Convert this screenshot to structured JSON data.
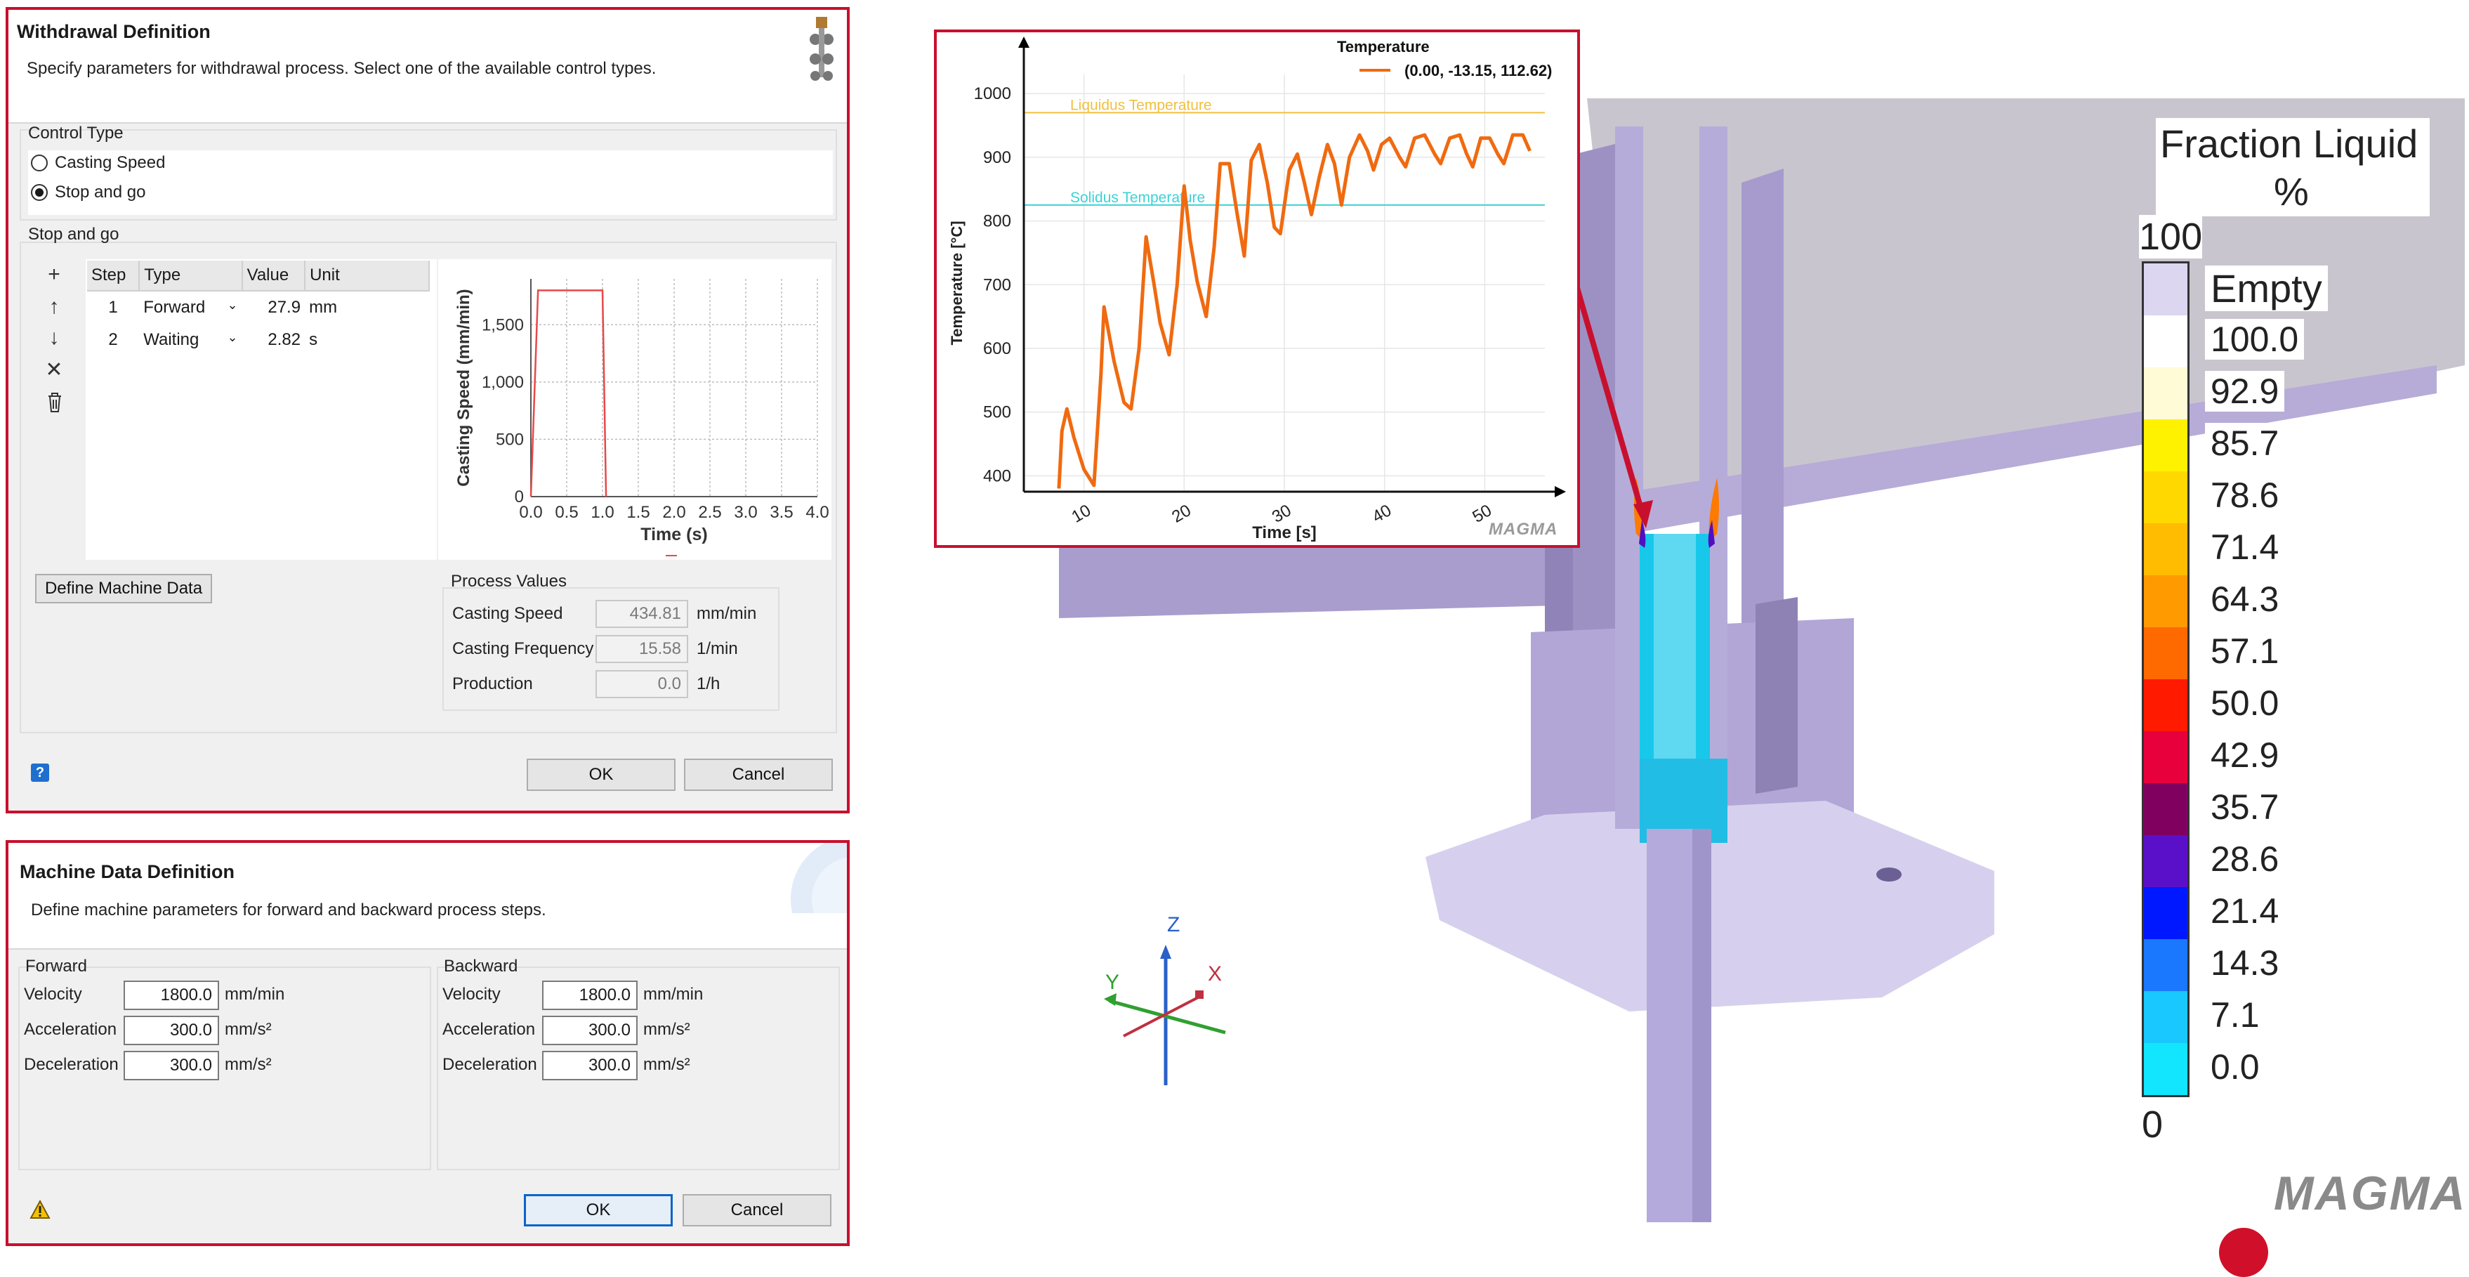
{
  "withdrawal": {
    "title": "Withdrawal Definition",
    "description": "Specify parameters for withdrawal process. Select one of the available control types.",
    "control_type_label": "Control Type",
    "radio_casting_speed": "Casting Speed",
    "radio_stop_and_go": "Stop and go",
    "selected": "Stop and go",
    "stop_and_go_label": "Stop and go",
    "table_headers": [
      "Step",
      "Type",
      "Value",
      "Unit"
    ],
    "steps": [
      {
        "step": "1",
        "type": "Forward",
        "value": "27.9",
        "unit": "mm"
      },
      {
        "step": "2",
        "type": "Waiting",
        "value": "2.82",
        "unit": "s"
      }
    ],
    "toolbar_icons": [
      "add-icon",
      "move-up-icon",
      "move-down-icon",
      "remove-icon",
      "delete-icon"
    ],
    "define_machine_data_button": "Define Machine Data",
    "process_values_label": "Process Values",
    "casting_speed_label": "Casting Speed",
    "casting_speed_value": "434.81",
    "casting_speed_unit": "mm/min",
    "casting_frequency_label": "Casting Frequency",
    "casting_frequency_value": "15.58",
    "casting_frequency_unit": "1/min",
    "production_label": "Production",
    "production_value": "0.0",
    "production_unit": "1/h",
    "ok_button": "OK",
    "cancel_button": "Cancel",
    "help_icon": "help-icon"
  },
  "machine": {
    "title": "Machine Data Definition",
    "description": "Define machine parameters for forward and backward process steps.",
    "forward_label": "Forward",
    "backward_label": "Backward",
    "velocity_label": "Velocity",
    "acceleration_label": "Acceleration",
    "deceleration_label": "Deceleration",
    "forward_velocity": "1800.0",
    "forward_acceleration": "300.0",
    "forward_deceleration": "300.0",
    "backward_velocity": "1800.0",
    "backward_acceleration": "300.0",
    "backward_deceleration": "300.0",
    "velocity_unit": "mm/min",
    "accel_unit": "mm/s²",
    "ok_button": "OK",
    "cancel_button": "Cancel",
    "warning_icon": "warning-icon"
  },
  "scale": {
    "title_line1": "Fraction Liquid",
    "title_line2": "%",
    "top_label": "100",
    "bottom_label": "0",
    "empty_label": "Empty",
    "labels": [
      "100.0",
      "92.9",
      "85.7",
      "78.6",
      "71.4",
      "64.3",
      "57.1",
      "50.0",
      "42.9",
      "35.7",
      "28.6",
      "21.4",
      "14.3",
      "7.1",
      "0.0"
    ],
    "colors": [
      "#ffffff",
      "#fffbd6",
      "#fff200",
      "#ffd800",
      "#ffbc00",
      "#ff9a00",
      "#ff6a00",
      "#ff1a00",
      "#e8003c",
      "#800060",
      "#5a10c8",
      "#0018ff",
      "#1a78ff",
      "#18c8ff",
      "#12e6ff"
    ],
    "empty_color": "#dcd6f0"
  },
  "axes_triad": {
    "x": "X",
    "y": "Y",
    "z": "Z"
  },
  "logo": "MAGMA",
  "chart_data": [
    {
      "type": "line",
      "title": "",
      "xlabel": "Time (s)",
      "ylabel": "Casting Speed (mm/min)",
      "xlim": [
        0,
        4.0
      ],
      "ylim": [
        0,
        1900
      ],
      "xticks": [
        "0.0",
        "0.5",
        "1.0",
        "1.5",
        "2.0",
        "2.5",
        "3.0",
        "3.5",
        "4.0"
      ],
      "yticks": [
        "0",
        "500",
        "1,000",
        "1,500"
      ],
      "series": [
        {
          "x": [
            0.0,
            0.1,
            1.0,
            1.05
          ],
          "y": [
            0,
            1800,
            1800,
            0
          ]
        }
      ],
      "color": "#e84848",
      "grid": true
    },
    {
      "type": "line",
      "title": "",
      "legend_title": "Temperature",
      "xlabel": "Time [s]",
      "ylabel": "Temperature [°C]",
      "xlim": [
        4,
        56
      ],
      "ylim": [
        375,
        1030
      ],
      "xticks": [
        "10",
        "20",
        "30",
        "40",
        "50"
      ],
      "yticks": [
        "400",
        "500",
        "600",
        "700",
        "800",
        "900",
        "1000"
      ],
      "annotations": [
        {
          "text": "Liquidus Temperature",
          "y": 970,
          "color": "#f0c040"
        },
        {
          "text": "Solidus Temperature",
          "y": 825,
          "color": "#3cd2d6"
        }
      ],
      "series": [
        {
          "name": "(0.00, -13.15, 112.62)",
          "color": "#f06a10",
          "x": [
            7.5,
            7.8,
            8.3,
            9.0,
            10.0,
            11.0,
            11.7,
            12.0,
            13.0,
            14.0,
            14.7,
            15.5,
            16.2,
            17.0,
            17.6,
            18.5,
            19.3,
            20.0,
            20.6,
            21.3,
            22.2,
            23.0,
            23.6,
            24.5,
            25.3,
            26.0,
            26.7,
            27.5,
            28.3,
            29.0,
            29.6,
            30.5,
            31.3,
            32.0,
            32.7,
            33.5,
            34.3,
            35.0,
            35.7,
            36.5,
            37.5,
            38.3,
            38.9,
            39.7,
            40.5,
            41.5,
            42.1,
            43.0,
            44.0,
            45.0,
            45.6,
            46.5,
            47.5,
            48.2,
            48.8,
            49.6,
            50.5,
            51.3,
            51.9,
            52.8,
            53.8,
            54.5
          ],
          "y": [
            380,
            470,
            505,
            460,
            410,
            385,
            560,
            665,
            580,
            515,
            505,
            600,
            775,
            700,
            640,
            590,
            700,
            855,
            770,
            705,
            650,
            760,
            890,
            890,
            810,
            745,
            895,
            920,
            860,
            790,
            780,
            880,
            905,
            860,
            810,
            870,
            920,
            890,
            825,
            900,
            935,
            910,
            880,
            920,
            930,
            900,
            885,
            930,
            935,
            905,
            890,
            930,
            935,
            905,
            885,
            930,
            930,
            905,
            890,
            935,
            935,
            910
          ]
        }
      ],
      "grid": true
    }
  ]
}
